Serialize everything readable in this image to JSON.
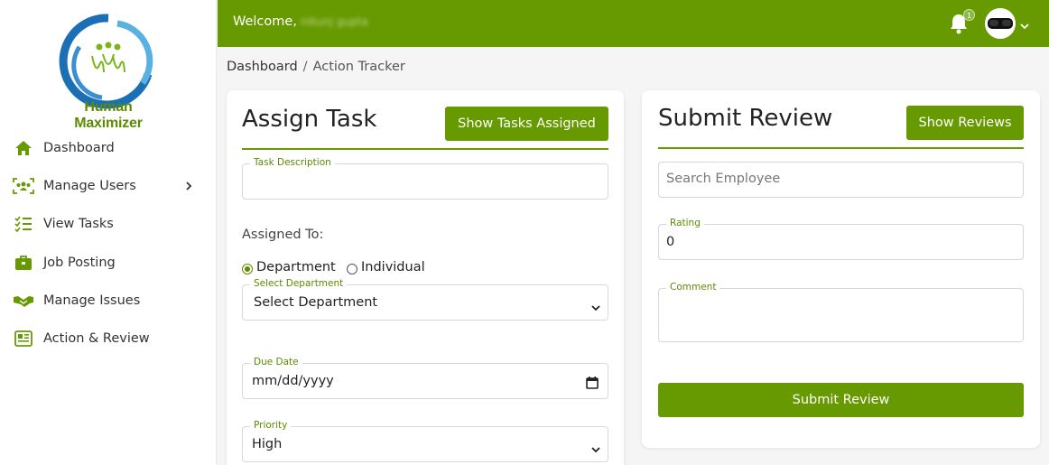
{
  "sidebar": {
    "brand": "Human Maximizer",
    "items": [
      {
        "label": "Dashboard",
        "icon": "home-icon"
      },
      {
        "label": "Manage Users",
        "icon": "users-icon"
      },
      {
        "label": "View Tasks",
        "icon": "checklist-icon"
      },
      {
        "label": "Job Posting",
        "icon": "briefcase-icon"
      },
      {
        "label": "Manage Issues",
        "icon": "handshake-icon"
      },
      {
        "label": "Action & Review",
        "icon": "newspaper-icon"
      }
    ]
  },
  "header": {
    "welcome": "Welcome,",
    "user_name": "nikunj gupta",
    "notification_count": "1"
  },
  "breadcrumb": {
    "root": "Dashboard",
    "separator": "/",
    "current": "Action Tracker"
  },
  "assign_task": {
    "title": "Assign Task",
    "show_button": "Show Tasks Assigned",
    "task_description_label": "Task Description",
    "task_description_value": "",
    "assigned_to_label": "Assigned To:",
    "radio_department": "Department",
    "radio_individual": "Individual",
    "select_department_label": "Select Department",
    "select_department_value": "Select Department",
    "due_date_label": "Due Date",
    "due_date_placeholder": "mm/dd/yyyy",
    "priority_label": "Priority",
    "priority_value": "High"
  },
  "submit_review": {
    "title": "Submit Review",
    "show_button": "Show Reviews",
    "search_placeholder": "Search Employee",
    "rating_label": "Rating",
    "rating_value": "0",
    "comment_label": "Comment",
    "comment_value": "",
    "submit_button": "Submit Review"
  },
  "colors": {
    "accent": "#679a01",
    "accent_text": "#5d8a00"
  }
}
